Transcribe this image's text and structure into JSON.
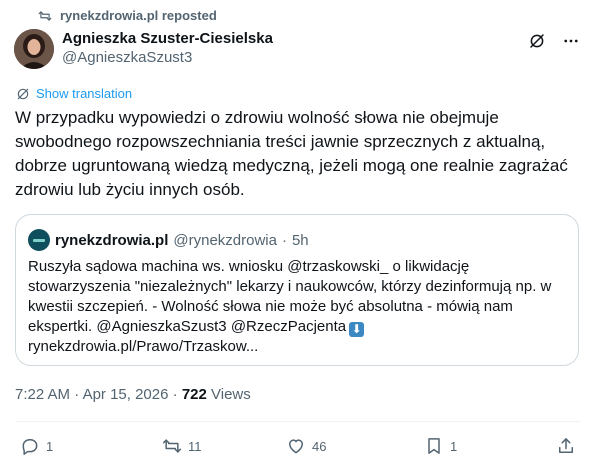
{
  "repost": {
    "text": "rynekzdrowia.pl reposted",
    "icon": "repost-icon"
  },
  "author": {
    "name": "Agnieszka Szuster-Ciesielska",
    "handle": "@AgnieszkaSzust3"
  },
  "translate": {
    "label": "Show translation",
    "icon": "globe-icon"
  },
  "tweet": {
    "lines": [
      "W przypadku wypowiedzi o zdrowiu wolność słowa nie obejmuje",
      "swobodnego rozpowszechniania treści jawnie sprzecznych z aktualną,",
      "dobrze ugruntowaną wiedzą medyczną, jeżeli mogą one realnie zagrażać",
      "zdrowiu lub życiu innych osób."
    ]
  },
  "quote": {
    "name": "rynekzdrowia.pl",
    "handle": "@rynekzdrowia",
    "separator": "·",
    "time": "5h",
    "lines": [
      "Ruszyła sądowa machina ws. wniosku @trzaskowski_ o likwidację",
      "stowarzyszenia \"niezależnych\" lekarzy i naukowców, którzy dezinformują np. w",
      "kwestii szczepień. - Wolność słowa nie może być absolutna - mówią nam",
      "ekspertki. @AgnieszkaSzust3 @RzeczPacjenta",
      "rynekzdrowia.pl/Prawo/Trzaskow..."
    ],
    "emoji": "⬇"
  },
  "meta": {
    "time": "7:22 AM",
    "separator1": "·",
    "date": "Apr 15, 2026",
    "separator2": "·",
    "views_count": "722",
    "views_label": "Views"
  },
  "actions": {
    "replies": "1",
    "reposts": "11",
    "likes": "46",
    "bookmarks": "1"
  },
  "colors": {
    "accent": "#1d9bf0",
    "secondary_text": "#536471",
    "border": "#cfd9de"
  }
}
